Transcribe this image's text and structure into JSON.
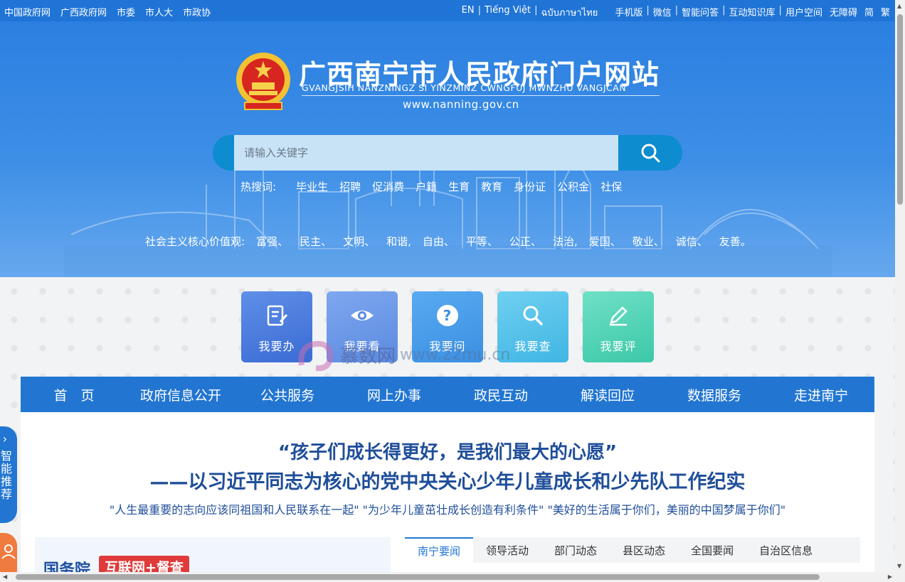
{
  "topbar": {
    "left_links": [
      "中国政府网",
      "广西政府网",
      "市委",
      "市人大",
      "市政协"
    ],
    "langs": [
      "EN",
      "Tiếng Việt",
      "ฉบับภาษาไทย"
    ],
    "right_links": [
      "手机版",
      "微信",
      "智能问答",
      "互动知识库",
      "用户空间",
      "无障碍",
      "简",
      "繁"
    ]
  },
  "header": {
    "title": "广西南宁市人民政府门户网站",
    "pinyin": "GVANGJSIH NANZNINGZ SI YINZMINZ CWNGFUJ MWNZHU VANGJCAN",
    "url": "www.nanning.gov.cn"
  },
  "search": {
    "placeholder": "请输入关键字",
    "hot_label": "热搜词:",
    "hot_words": [
      "毕业生",
      "招聘",
      "促消费",
      "户籍",
      "生育",
      "教育",
      "身份证",
      "公积金",
      "社保"
    ]
  },
  "values": {
    "label": "社会主义核心价值观:",
    "items": [
      "富强、",
      "民主、",
      "文明、",
      "和谐,",
      "自由、",
      "平等、",
      "公正、",
      "法治,",
      "爱国、",
      "敬业、",
      "诚信、",
      "友善。"
    ]
  },
  "tiles": [
    "我要办",
    "我要看",
    "我要问",
    "我要查",
    "我要评"
  ],
  "watermark": {
    "text": "慕数网",
    "url": "www.22mu.cn"
  },
  "nav": [
    "首　页",
    "政府信息公开",
    "公共服务",
    "网上办事",
    "政民互动",
    "解读回应",
    "数据服务",
    "走进南宁"
  ],
  "headline": {
    "line1": "“孩子们成长得更好，是我们最大的心愿”",
    "line2": "——以习近平同志为核心的党中央关心少年儿童成长和少先队工作纪实",
    "subheads": "\"人生最重要的志向应该同祖国和人民联系在一起\" \"为少年儿童茁壮成长创造有利条件\" \"美好的生活属于你们，美丽的中国梦属于你们\""
  },
  "banner": {
    "left": "国务院",
    "badge": "互联网+督查"
  },
  "news_tabs": [
    "南宁要闻",
    "领导活动",
    "部门动态",
    "县区动态",
    "全国要闻",
    "自治区信息"
  ],
  "side": {
    "label": "智能推荐"
  },
  "colors": {
    "primary": "#2276d2",
    "headline": "#1f4e9a",
    "badge": "#e03a3a"
  }
}
